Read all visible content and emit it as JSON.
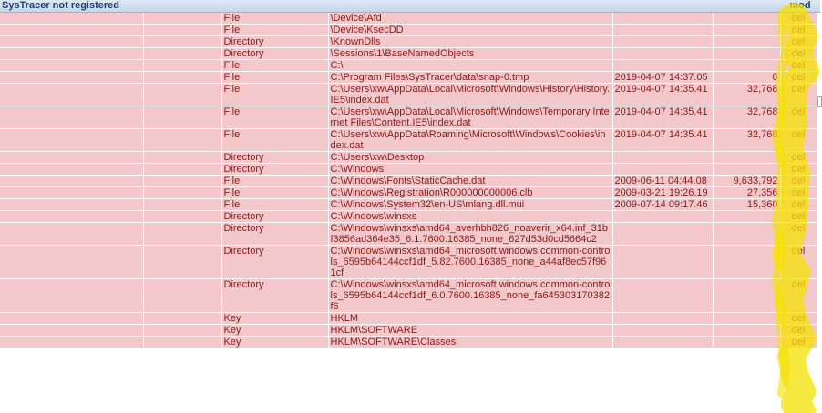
{
  "header": {
    "title": "SysTracer not registered",
    "mod_label": "mod"
  },
  "colors": {
    "row_bg": "#f3c8cb",
    "text": "#8b1a1a",
    "highlight": "#f5e100"
  },
  "rows": [
    {
      "type": "File",
      "path": "\\Device\\Afd",
      "date": "",
      "size": "",
      "action": "del"
    },
    {
      "type": "File",
      "path": "\\Device\\KsecDD",
      "date": "",
      "size": "",
      "action": "del"
    },
    {
      "type": "Directory",
      "path": "\\KnownDlls",
      "date": "",
      "size": "",
      "action": "del"
    },
    {
      "type": "Directory",
      "path": "\\Sessions\\1\\BaseNamedObjects",
      "date": "",
      "size": "",
      "action": "del"
    },
    {
      "type": "File",
      "path": "C:\\",
      "date": "",
      "size": "",
      "action": "del"
    },
    {
      "type": "File",
      "path": "C:\\Program Files\\SysTracer\\data\\snap-0.tmp",
      "date": "2019-04-07 14:37.05",
      "size": "0",
      "action": "del"
    },
    {
      "type": "File",
      "path": "C:\\Users\\xw\\AppData\\Local\\Microsoft\\Windows\\History\\History.IE5\\index.dat",
      "date": "2019-04-07 14:35.41",
      "size": "32,768",
      "action": "del"
    },
    {
      "type": "File",
      "path": "C:\\Users\\xw\\AppData\\Local\\Microsoft\\Windows\\Temporary Internet Files\\Content.IE5\\index.dat",
      "date": "2019-04-07 14:35.41",
      "size": "32,768",
      "action": "del"
    },
    {
      "type": "File",
      "path": "C:\\Users\\xw\\AppData\\Roaming\\Microsoft\\Windows\\Cookies\\index.dat",
      "date": "2019-04-07 14:35.41",
      "size": "32,768",
      "action": "del"
    },
    {
      "type": "Directory",
      "path": "C:\\Users\\xw\\Desktop",
      "date": "",
      "size": "",
      "action": "del"
    },
    {
      "type": "Directory",
      "path": "C:\\Windows",
      "date": "",
      "size": "",
      "action": "del"
    },
    {
      "type": "File",
      "path": "C:\\Windows\\Fonts\\StaticCache.dat",
      "date": "2009-06-11 04:44.08",
      "size": "9,633,792",
      "action": "del"
    },
    {
      "type": "File",
      "path": "C:\\Windows\\Registration\\R000000000006.clb",
      "date": "2009-03-21 19:26.19",
      "size": "27,356",
      "action": "del"
    },
    {
      "type": "File",
      "path": "C:\\Windows\\System32\\en-US\\mlang.dll.mui",
      "date": "2009-07-14 09:17.46",
      "size": "15,360",
      "action": "del"
    },
    {
      "type": "Directory",
      "path": "C:\\Windows\\winsxs",
      "date": "",
      "size": "",
      "action": "del"
    },
    {
      "type": "Directory",
      "path": "C:\\Windows\\winsxs\\amd64_averhbh826_noaverir_x64.inf_31bf3856ad364e35_6.1.7600.16385_none_627d53d0cd5664c2",
      "date": "",
      "size": "",
      "action": "del"
    },
    {
      "type": "Directory",
      "path": "C:\\Windows\\winsxs\\amd64_microsoft.windows.common-controls_6595b64144ccf1df_5.82.7600.16385_none_a44af8ec57f961cf",
      "date": "",
      "size": "",
      "action": "del"
    },
    {
      "type": "Directory",
      "path": "C:\\Windows\\winsxs\\amd64_microsoft.windows.common-controls_6595b64144ccf1df_6.0.7600.16385_none_fa645303170382f6",
      "date": "",
      "size": "",
      "action": "del"
    },
    {
      "type": "Key",
      "path": "HKLM",
      "date": "",
      "size": "",
      "action": "del"
    },
    {
      "type": "Key",
      "path": "HKLM\\SOFTWARE",
      "date": "",
      "size": "",
      "action": "del"
    },
    {
      "type": "Key",
      "path": "HKLM\\SOFTWARE\\Classes",
      "date": "",
      "size": "",
      "action": "del"
    }
  ]
}
